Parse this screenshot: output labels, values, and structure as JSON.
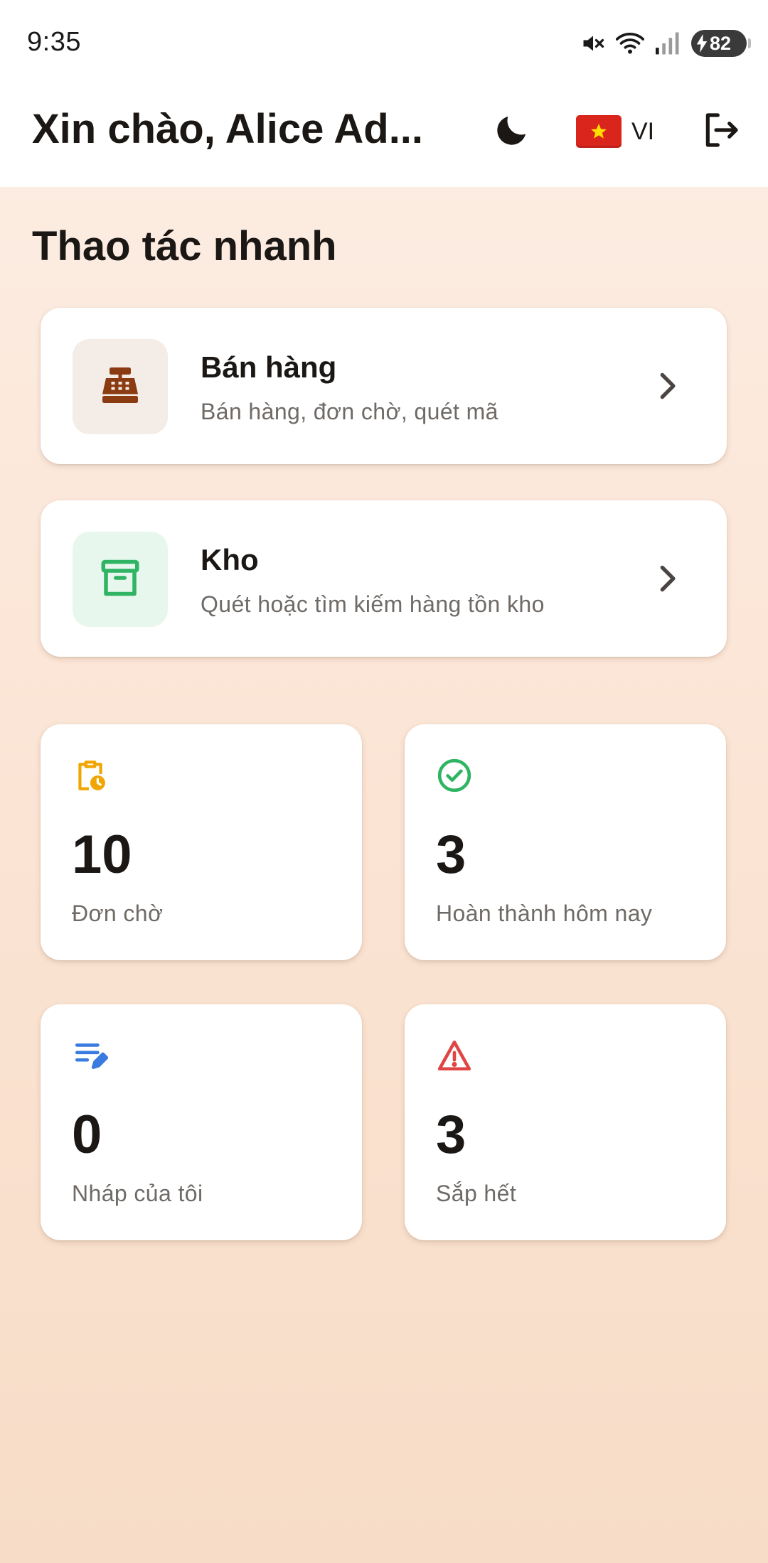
{
  "status_bar": {
    "time": "9:35",
    "battery": "82",
    "icons": [
      "mute-icon",
      "wifi-icon",
      "signal-icon",
      "battery-charging-icon"
    ]
  },
  "header": {
    "greeting": "Xin chào, Alice Ad...",
    "theme_icon": "moon-icon",
    "language_code": "VI",
    "flag_icon": "vietnam-flag-icon",
    "logout_icon": "logout-icon"
  },
  "quick_actions": {
    "title": "Thao tác nhanh",
    "items": [
      {
        "title": "Bán hàng",
        "subtitle": "Bán hàng, đơn chờ, quét mã",
        "icon": "cash-register-icon",
        "accent": "#8a3b12"
      },
      {
        "title": "Kho",
        "subtitle": "Quét hoặc tìm kiếm hàng tồn kho",
        "icon": "archive-box-icon",
        "accent": "#2fb463"
      }
    ]
  },
  "stats": [
    {
      "value": "10",
      "label": "Đơn chờ",
      "icon": "clipboard-clock-icon",
      "color": "#f0a500"
    },
    {
      "value": "3",
      "label": "Hoàn thành hôm nay",
      "icon": "check-circle-icon",
      "color": "#2fb463"
    },
    {
      "value": "0",
      "label": "Nháp của tôi",
      "icon": "edit-note-icon",
      "color": "#3a7be0"
    },
    {
      "value": "3",
      "label": "Sắp hết",
      "icon": "warning-icon",
      "color": "#e04545"
    }
  ]
}
